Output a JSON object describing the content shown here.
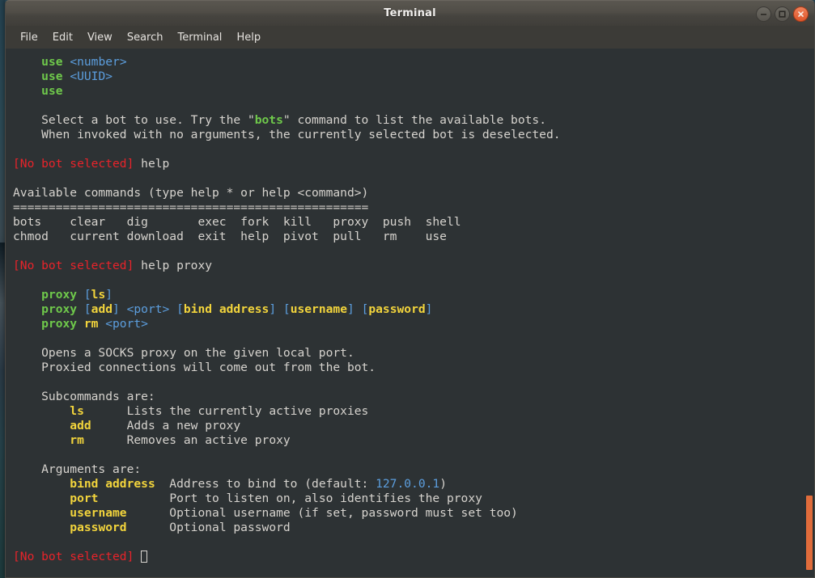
{
  "window": {
    "title": "Terminal",
    "controls": [
      {
        "name": "minimize-button",
        "glyph": "minimize"
      },
      {
        "name": "maximize-button",
        "glyph": "maximize"
      },
      {
        "name": "close-button",
        "glyph": "close"
      }
    ]
  },
  "menubar": {
    "items": [
      "File",
      "Edit",
      "View",
      "Search",
      "Terminal",
      "Help"
    ]
  },
  "colors": {
    "background": "#2d3234",
    "foreground": "#d6d3ce",
    "green": "#6fc94b",
    "blue": "#5c9ede",
    "yellow": "#f2d43c",
    "red": "#e8232a",
    "accent_orange": "#e06c3b",
    "titlebar": "#4e4b45"
  },
  "prompt": "[No bot selected]",
  "scrollbar": {
    "thumb_top_pct": 84.5,
    "thumb_height_pct": 14.2
  },
  "terminal": {
    "lines": [
      [
        {
          "t": "    ",
          "c": "w"
        },
        {
          "t": "use ",
          "c": "g"
        },
        {
          "t": "<number>",
          "c": "b"
        }
      ],
      [
        {
          "t": "    ",
          "c": "w"
        },
        {
          "t": "use ",
          "c": "g"
        },
        {
          "t": "<UUID>",
          "c": "b"
        }
      ],
      [
        {
          "t": "    ",
          "c": "w"
        },
        {
          "t": "use",
          "c": "g"
        }
      ],
      [],
      [
        {
          "t": "    Select a bot to use. Try the \"",
          "c": "w"
        },
        {
          "t": "bots",
          "c": "g"
        },
        {
          "t": "\" command to list the available bots.",
          "c": "w"
        }
      ],
      [
        {
          "t": "    When invoked with no arguments, the currently selected bot is deselected.",
          "c": "w"
        }
      ],
      [],
      [
        {
          "t": "[No bot selected]",
          "c": "r"
        },
        {
          "t": " help",
          "c": "w"
        }
      ],
      [],
      [
        {
          "t": "Available commands (type help * or help <command>)",
          "c": "w"
        }
      ],
      [
        {
          "t": "==================================================",
          "c": "w"
        }
      ],
      [
        {
          "t": "bots    clear   dig       exec  fork  kill   proxy  push  shell",
          "c": "w"
        }
      ],
      [
        {
          "t": "chmod   current download  exit  help  pivot  pull   rm    use",
          "c": "w"
        }
      ],
      [],
      [
        {
          "t": "[No bot selected]",
          "c": "r"
        },
        {
          "t": " help proxy",
          "c": "w"
        }
      ],
      [],
      [
        {
          "t": "    ",
          "c": "w"
        },
        {
          "t": "proxy",
          "c": "g"
        },
        {
          "t": " [",
          "c": "b"
        },
        {
          "t": "ls",
          "c": "y"
        },
        {
          "t": "]",
          "c": "b"
        }
      ],
      [
        {
          "t": "    ",
          "c": "w"
        },
        {
          "t": "proxy",
          "c": "g"
        },
        {
          "t": " [",
          "c": "b"
        },
        {
          "t": "add",
          "c": "y"
        },
        {
          "t": "] <port> [",
          "c": "b"
        },
        {
          "t": "bind address",
          "c": "y"
        },
        {
          "t": "] [",
          "c": "b"
        },
        {
          "t": "username",
          "c": "y"
        },
        {
          "t": "] [",
          "c": "b"
        },
        {
          "t": "password",
          "c": "y"
        },
        {
          "t": "]",
          "c": "b"
        }
      ],
      [
        {
          "t": "    ",
          "c": "w"
        },
        {
          "t": "proxy ",
          "c": "g"
        },
        {
          "t": "rm",
          "c": "y"
        },
        {
          "t": " <port>",
          "c": "b"
        }
      ],
      [],
      [
        {
          "t": "    Opens a SOCKS proxy on the given local port.",
          "c": "w"
        }
      ],
      [
        {
          "t": "    Proxied connections will come out from the bot.",
          "c": "w"
        }
      ],
      [],
      [
        {
          "t": "    Subcommands are:",
          "c": "w"
        }
      ],
      [
        {
          "t": "        ",
          "c": "w"
        },
        {
          "t": "ls",
          "c": "y"
        },
        {
          "t": "      Lists the currently active proxies",
          "c": "w"
        }
      ],
      [
        {
          "t": "        ",
          "c": "w"
        },
        {
          "t": "add",
          "c": "y"
        },
        {
          "t": "     Adds a new proxy",
          "c": "w"
        }
      ],
      [
        {
          "t": "        ",
          "c": "w"
        },
        {
          "t": "rm",
          "c": "y"
        },
        {
          "t": "      Removes an active proxy",
          "c": "w"
        }
      ],
      [],
      [
        {
          "t": "    Arguments are:",
          "c": "w"
        }
      ],
      [
        {
          "t": "        ",
          "c": "w"
        },
        {
          "t": "bind address",
          "c": "y"
        },
        {
          "t": "  Address to bind to (default: ",
          "c": "w"
        },
        {
          "t": "127.0.0.1",
          "c": "b"
        },
        {
          "t": ")",
          "c": "w"
        }
      ],
      [
        {
          "t": "        ",
          "c": "w"
        },
        {
          "t": "port",
          "c": "y"
        },
        {
          "t": "          Port to listen on, also identifies the proxy",
          "c": "w"
        }
      ],
      [
        {
          "t": "        ",
          "c": "w"
        },
        {
          "t": "username",
          "c": "y"
        },
        {
          "t": "      Optional username (if set, password must set too)",
          "c": "w"
        }
      ],
      [
        {
          "t": "        ",
          "c": "w"
        },
        {
          "t": "password",
          "c": "y"
        },
        {
          "t": "      Optional password",
          "c": "w"
        }
      ],
      [],
      [
        {
          "t": "[No bot selected]",
          "c": "r"
        },
        {
          "t": " ",
          "c": "w"
        },
        {
          "t": "",
          "c": "cursor"
        }
      ]
    ]
  }
}
